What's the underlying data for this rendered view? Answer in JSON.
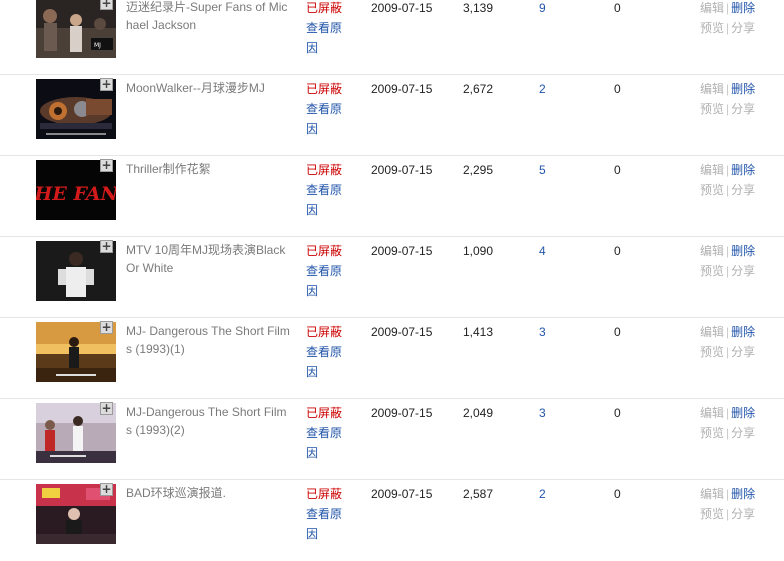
{
  "rows": [
    {
      "title": "迈迷纪录片-Super Fans of Michael Jackson",
      "status": "已屏蔽",
      "reason": "查看原因",
      "date": "2009-07-15",
      "plays": "3,139",
      "comments": "9",
      "favorites": "0",
      "actions": {
        "edit": "编辑",
        "delete": "删除",
        "preview": "预览",
        "share": "分享"
      },
      "thumb_icon": "video-thumbnail-crowd"
    },
    {
      "title": "MoonWalker--月球漫步MJ",
      "status": "已屏蔽",
      "reason": "查看原因",
      "date": "2009-07-15",
      "plays": "2,672",
      "comments": "2",
      "favorites": "0",
      "actions": {
        "edit": "编辑",
        "delete": "删除",
        "preview": "预览",
        "share": "分享"
      },
      "thumb_icon": "video-thumbnail-machine"
    },
    {
      "title": "Thriller制作花絮",
      "status": "已屏蔽",
      "reason": "查看原因",
      "date": "2009-07-15",
      "plays": "2,295",
      "comments": "5",
      "favorites": "0",
      "actions": {
        "edit": "编辑",
        "delete": "删除",
        "preview": "预览",
        "share": "分享"
      },
      "thumb_icon": "video-thumbnail-fans-logo",
      "thumb_text": "THE FANS"
    },
    {
      "title": "MTV 10周年MJ现场表演Black Or White",
      "status": "已屏蔽",
      "reason": "查看原因",
      "date": "2009-07-15",
      "plays": "1,090",
      "comments": "4",
      "favorites": "0",
      "actions": {
        "edit": "编辑",
        "delete": "删除",
        "preview": "预览",
        "share": "分享"
      },
      "thumb_icon": "video-thumbnail-performer"
    },
    {
      "title": "MJ- Dangerous The Short Films (1993)(1)",
      "status": "已屏蔽",
      "reason": "查看原因",
      "date": "2009-07-15",
      "plays": "1,413",
      "comments": "3",
      "favorites": "0",
      "actions": {
        "edit": "编辑",
        "delete": "删除",
        "preview": "预览",
        "share": "分享"
      },
      "thumb_icon": "video-thumbnail-stage"
    },
    {
      "title": "MJ-Dangerous The Short Films (1993)(2)",
      "status": "已屏蔽",
      "reason": "查看原因",
      "date": "2009-07-15",
      "plays": "2,049",
      "comments": "3",
      "favorites": "0",
      "actions": {
        "edit": "编辑",
        "delete": "删除",
        "preview": "预览",
        "share": "分享"
      },
      "thumb_icon": "video-thumbnail-dancers"
    },
    {
      "title": "BAD环球巡演报道.",
      "status": "已屏蔽",
      "reason": "查看原因",
      "date": "2009-07-15",
      "plays": "2,587",
      "comments": "2",
      "favorites": "0",
      "actions": {
        "edit": "编辑",
        "delete": "删除",
        "preview": "预览",
        "share": "分享"
      },
      "thumb_icon": "video-thumbnail-street"
    }
  ],
  "add_symbol": "+"
}
